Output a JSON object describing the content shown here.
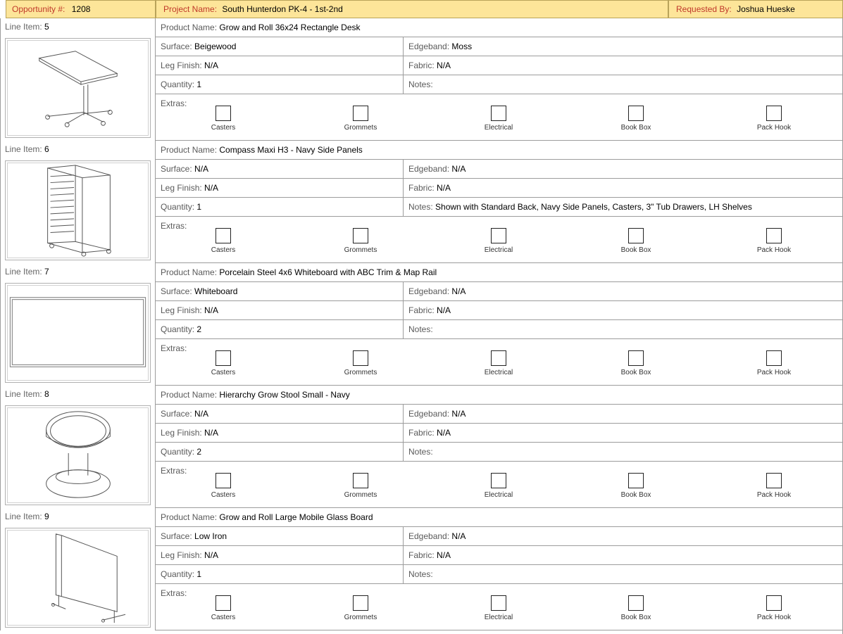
{
  "header": {
    "opportunity_label": "Opportunity #:",
    "opportunity_value": "1208",
    "project_label": "Project Name:",
    "project_value": "South Hunterdon PK-4 - 1st-2nd",
    "requested_label": "Requested By:",
    "requested_value": "Joshua Hueske"
  },
  "labels": {
    "line_item": "Line Item:",
    "product_name": "Product Name:",
    "surface": "Surface:",
    "edgeband": "Edgeband:",
    "leg_finish": "Leg Finish:",
    "fabric": "Fabric:",
    "quantity": "Quantity:",
    "notes": "Notes:",
    "extras": "Extras:"
  },
  "extras_options": [
    "Casters",
    "Grommets",
    "Electrical",
    "Book Box",
    "Pack Hook"
  ],
  "items": [
    {
      "line": "5",
      "product": "Grow and Roll 36x24 Rectangle Desk",
      "surface": "Beigewood",
      "edgeband": "Moss",
      "leg_finish": "N/A",
      "fabric": "N/A",
      "quantity": "1",
      "notes": "",
      "image_icon": "desk-icon"
    },
    {
      "line": "6",
      "product": "Compass Maxi H3 - Navy Side Panels",
      "surface": "N/A",
      "edgeband": "N/A",
      "leg_finish": "N/A",
      "fabric": "N/A",
      "quantity": "1",
      "notes": "Shown with Standard Back, Navy Side Panels, Casters, 3\" Tub Drawers, LH Shelves",
      "image_icon": "storage-cabinet-icon"
    },
    {
      "line": "7",
      "product": "Porcelain Steel 4x6 Whiteboard with ABC Trim & Map Rail",
      "surface": "Whiteboard",
      "edgeband": "N/A",
      "leg_finish": "N/A",
      "fabric": "N/A",
      "quantity": "2",
      "notes": "",
      "image_icon": "whiteboard-icon"
    },
    {
      "line": "8",
      "product": "Hierarchy Grow Stool Small - Navy",
      "surface": "N/A",
      "edgeband": "N/A",
      "leg_finish": "N/A",
      "fabric": "N/A",
      "quantity": "2",
      "notes": "",
      "image_icon": "stool-icon"
    },
    {
      "line": "9",
      "product": "Grow and Roll Large Mobile Glass Board",
      "surface": "Low Iron",
      "edgeband": "N/A",
      "leg_finish": "N/A",
      "fabric": "N/A",
      "quantity": "1",
      "notes": "",
      "image_icon": "mobile-glass-board-icon"
    }
  ]
}
